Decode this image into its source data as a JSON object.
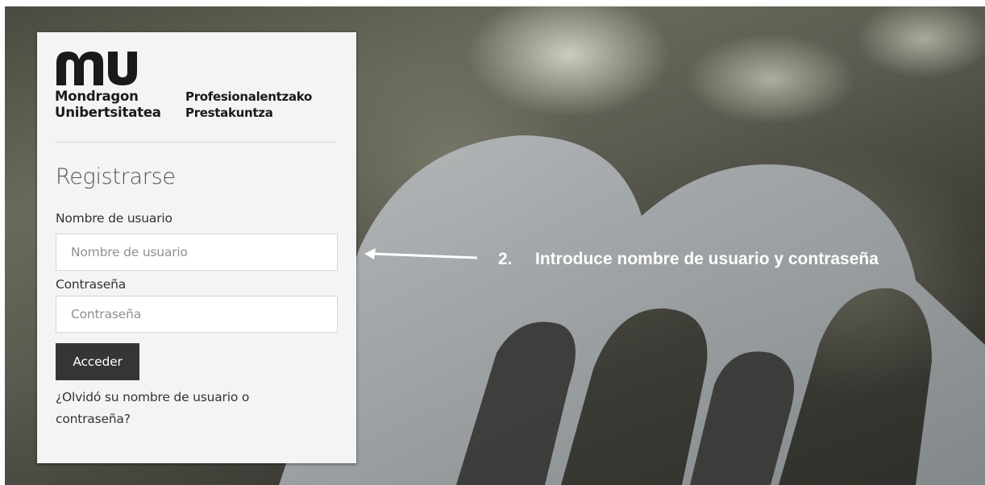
{
  "branding": {
    "logo_name_line1": "Mondragon",
    "logo_name_line2": "Unibertsitatea",
    "logo_sub_line1": "Profesionalentzako",
    "logo_sub_line2": "Prestakuntza"
  },
  "login": {
    "title": "Registrarse",
    "username_label": "Nombre de usuario",
    "username_placeholder": "Nombre de usuario",
    "username_value": "",
    "password_label": "Contraseña",
    "password_placeholder": "Contraseña",
    "password_value": "",
    "submit_label": "Acceder",
    "forgot_link": "¿Olvidó su nombre de usuario o contraseña?"
  },
  "annotation": {
    "number": "2.",
    "text": "Introduce nombre de usuario y contraseña"
  },
  "colors": {
    "panel_bg": "#f4f4f4",
    "button_bg": "#353535",
    "annotation_text": "#ffffff"
  }
}
